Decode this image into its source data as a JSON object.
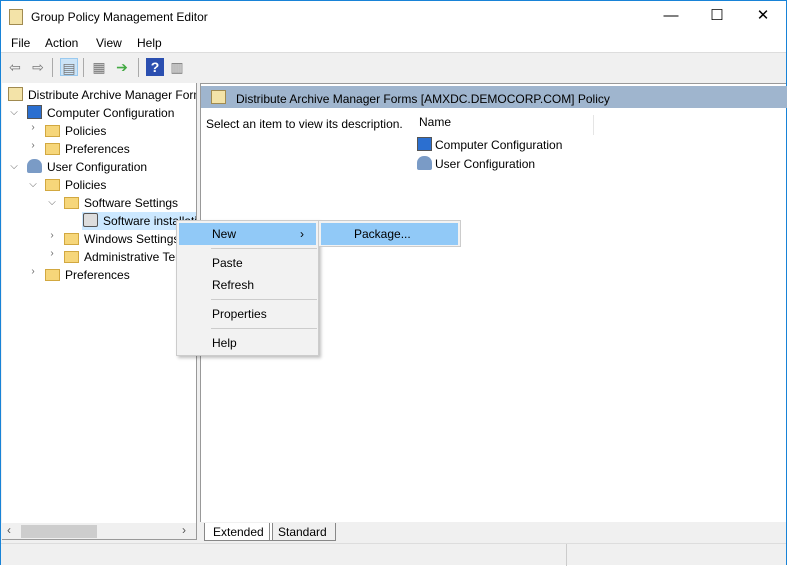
{
  "window": {
    "title": "Group Policy Management Editor",
    "minimize": "—",
    "maximize": "☐",
    "close": "✕"
  },
  "menu": [
    "File",
    "Action",
    "View",
    "Help"
  ],
  "toolbar": {
    "icons": [
      "back-icon",
      "forward-icon",
      "show-hide-tree-icon",
      "properties-icon",
      "export-list-icon",
      "help-icon",
      "show-action-pane-icon"
    ]
  },
  "tree": [
    {
      "label": "Distribute Archive Manager Forms [AMXDC.DEMOCORP.COM] Policy",
      "level": 0,
      "icon": "policy-scroll-icon"
    },
    {
      "label": "Computer Configuration",
      "level": 0,
      "expanded": true,
      "icon": "computer-icon"
    },
    {
      "label": "Policies",
      "level": 1,
      "expanded": false,
      "icon": "folder-icon"
    },
    {
      "label": "Preferences",
      "level": 1,
      "expanded": false,
      "icon": "folder-icon"
    },
    {
      "label": "User Configuration",
      "level": 0,
      "expanded": true,
      "icon": "user-icon"
    },
    {
      "label": "Policies",
      "level": 1,
      "expanded": true,
      "icon": "folder-icon"
    },
    {
      "label": "Software Settings",
      "level": 2,
      "expanded": true,
      "icon": "folder-icon"
    },
    {
      "label": "Software installation",
      "level": 3,
      "selected": true,
      "icon": "software-install-icon"
    },
    {
      "label": "Windows Settings",
      "level": 2,
      "expanded": false,
      "icon": "folder-icon"
    },
    {
      "label": "Administrative Templates",
      "level": 2,
      "expanded": false,
      "icon": "folder-icon"
    },
    {
      "label": "Preferences",
      "level": 1,
      "expanded": false,
      "icon": "folder-icon"
    }
  ],
  "right": {
    "header": "Distribute Archive Manager Forms [AMXDC.DEMOCORP.COM] Policy",
    "description": "Select an item to view its description.",
    "column": "Name",
    "items": [
      "Computer Configuration",
      "User Configuration"
    ]
  },
  "tabs": [
    "Extended",
    "Standard"
  ],
  "context_menu": {
    "items": [
      "New",
      "Paste",
      "Refresh",
      "Properties",
      "Help"
    ],
    "submenu": [
      "Package..."
    ]
  },
  "colors": {
    "accent": "#1883d7",
    "highlight": "#91c9f7",
    "header": "#9fb5ce"
  }
}
